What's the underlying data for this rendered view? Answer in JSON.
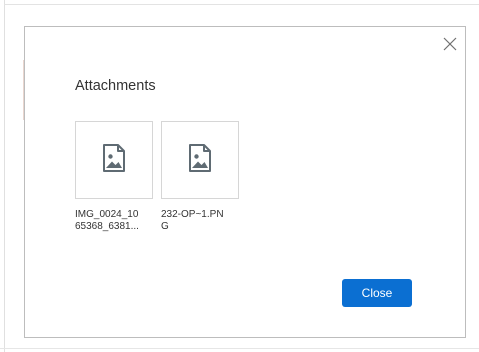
{
  "dialog": {
    "title": "Attachments",
    "close_icon": "close-icon",
    "close_button_label": "Close",
    "accent_color": "#0b6fd2"
  },
  "attachments": [
    {
      "filename_line1": "IMG_0024_10",
      "filename_line2": "65368_6381...",
      "icon": "image-file-icon"
    },
    {
      "filename_line1": "232-OP~1.PN",
      "filename_line2": "G",
      "icon": "image-file-icon"
    }
  ]
}
